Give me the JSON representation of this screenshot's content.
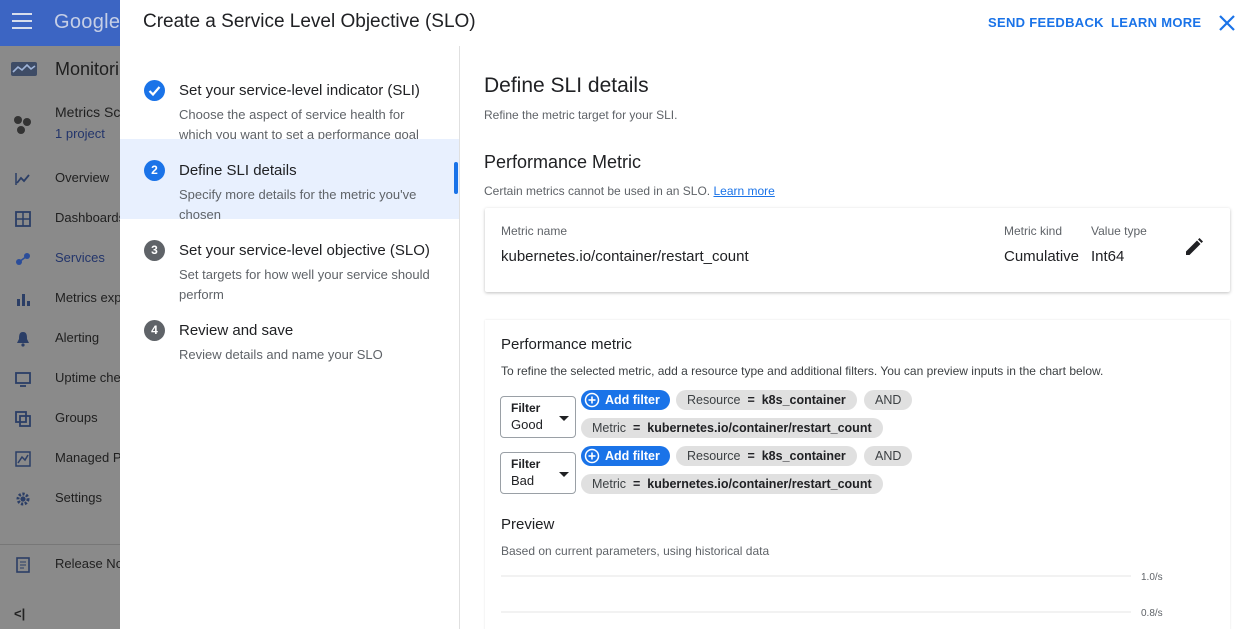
{
  "background_app": {
    "brand": "Google",
    "product": "Monitoring",
    "scope_title": "Metrics Scope",
    "scope_sub": "1 project",
    "nav": [
      {
        "label": "Overview",
        "icon": "chart-line-icon"
      },
      {
        "label": "Dashboards",
        "icon": "dashboard-icon"
      },
      {
        "label": "Services",
        "icon": "services-icon",
        "active": true
      },
      {
        "label": "Metrics explorer",
        "icon": "bar-chart-icon"
      },
      {
        "label": "Alerting",
        "icon": "bell-icon"
      },
      {
        "label": "Uptime checks",
        "icon": "monitor-icon"
      },
      {
        "label": "Groups",
        "icon": "groups-icon"
      },
      {
        "label": "Managed Prometheus",
        "icon": "prometheus-icon"
      },
      {
        "label": "Settings",
        "icon": "gear-icon"
      }
    ],
    "release_notes": "Release Notes",
    "collapse": "<|"
  },
  "dialog": {
    "title": "Create a Service Level Objective (SLO)",
    "send_feedback": "SEND FEEDBACK",
    "learn_more": "LEARN MORE",
    "steps": [
      {
        "marker": "",
        "title": "Set your service-level indicator (SLI)",
        "desc": "Choose the aspect of service health for which you want to set a performance goal",
        "state": "done"
      },
      {
        "marker": "2",
        "title": "Define SLI details",
        "desc": "Specify more details for the metric you've chosen",
        "state": "active"
      },
      {
        "marker": "3",
        "title": "Set your service-level objective (SLO)",
        "desc": "Set targets for how well your service should perform",
        "state": "pending"
      },
      {
        "marker": "4",
        "title": "Review and save",
        "desc": "Review details and name your SLO",
        "state": "pending"
      }
    ],
    "main": {
      "heading": "Define SLI details",
      "subheading": "Refine the metric target for your SLI.",
      "perf_heading": "Performance Metric",
      "perf_note": "Certain metrics cannot be used in an SLO.",
      "perf_note_link": "Learn more",
      "metric": {
        "name_label": "Metric name",
        "name_value": "kubernetes.io/container/restart_count",
        "kind_label": "Metric kind",
        "kind_value": "Cumulative",
        "type_label": "Value type",
        "type_value": "Int64"
      },
      "perf_card": {
        "title": "Performance metric",
        "desc": "To refine the selected metric, add a resource type and additional filters. You can preview inputs in the chart below.",
        "filters": [
          {
            "label": "Filter",
            "value": "Good",
            "add_label": "Add filter",
            "resource_key": "Resource",
            "resource_eq": "=",
            "resource_val": "k8s_container",
            "and": "AND",
            "metric_key": "Metric",
            "metric_eq": "=",
            "metric_val": "kubernetes.io/container/restart_count"
          },
          {
            "label": "Filter",
            "value": "Bad",
            "add_label": "Add filter",
            "resource_key": "Resource",
            "resource_eq": "=",
            "resource_val": "k8s_container",
            "and": "AND",
            "metric_key": "Metric",
            "metric_eq": "=",
            "metric_val": "kubernetes.io/container/restart_count"
          }
        ],
        "preview_title": "Preview",
        "preview_desc": "Based on current parameters, using historical data",
        "y_ticks": [
          "1.0/s",
          "0.8/s"
        ]
      }
    }
  },
  "colors": {
    "accent": "#1a73e8",
    "active_step_bg": "#e8f0fe",
    "scrim_sidebar": "#8a8a8a",
    "scrim_topbar": "#3c65c3",
    "chip_bg": "#e0e0e0"
  }
}
